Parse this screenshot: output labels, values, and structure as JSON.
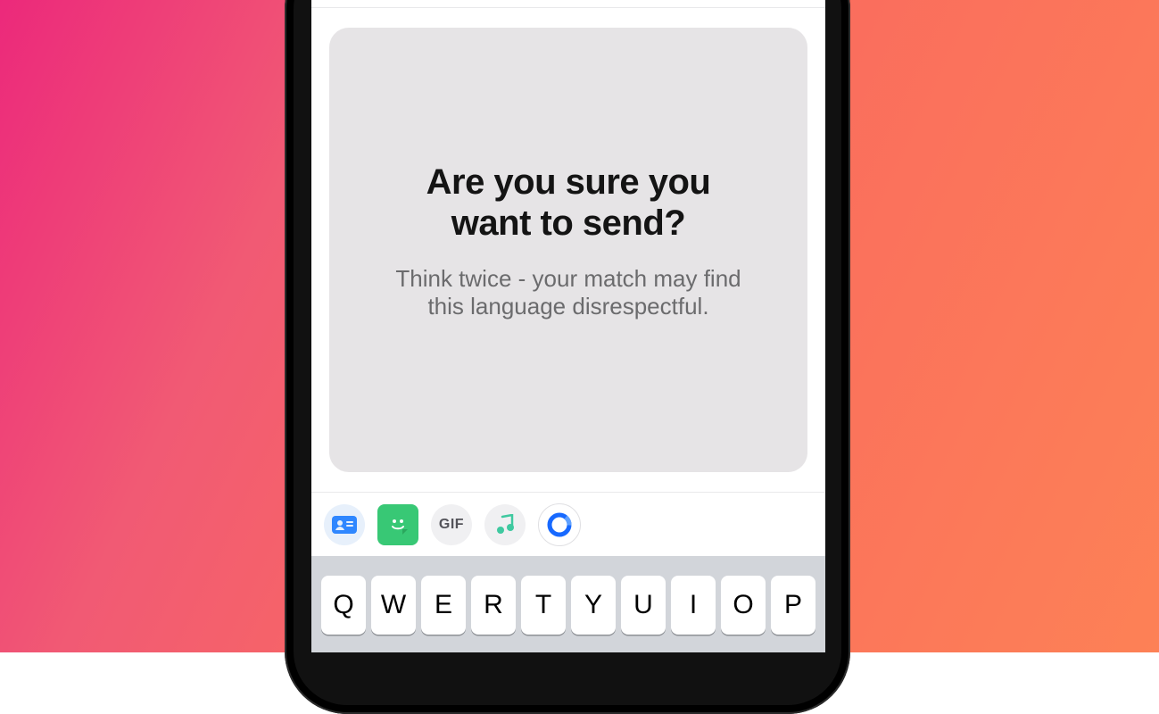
{
  "dialog": {
    "title_line1": "Are you sure you",
    "title_line2": "want to send?",
    "body_line1": "Think twice - your match may find",
    "body_line2": "this language disrespectful."
  },
  "toolbar": {
    "contact_label": "contact-card",
    "sticker_label": "sticker",
    "gif_label": "GIF",
    "music_label": "music",
    "noom_label": "noom"
  },
  "keyboard": {
    "row1": [
      "Q",
      "W",
      "E",
      "R",
      "T",
      "Y",
      "U",
      "I",
      "O",
      "P"
    ]
  }
}
